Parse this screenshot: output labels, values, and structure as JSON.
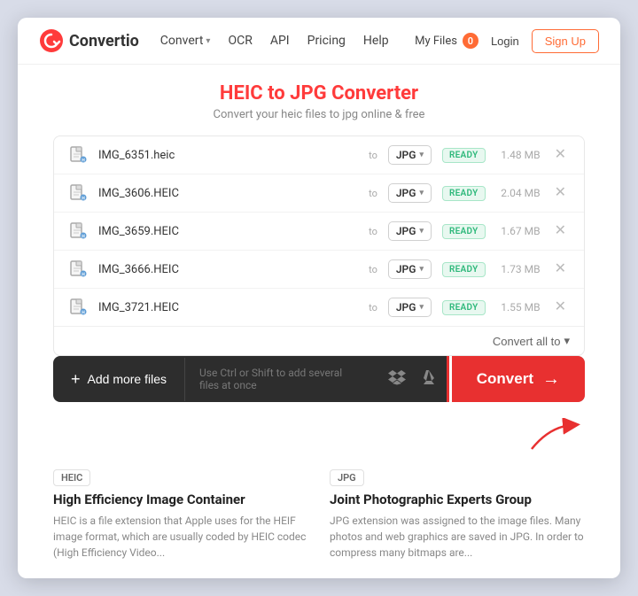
{
  "site": {
    "logo_text": "Convertio",
    "nav": {
      "convert": "Convert",
      "ocr": "OCR",
      "api": "API",
      "pricing": "Pricing",
      "help": "Help",
      "my_files": "My Files",
      "my_files_count": "0",
      "login": "Login",
      "signup": "Sign Up"
    }
  },
  "page": {
    "title": "HEIC to JPG Converter",
    "subtitle": "Convert your heic files to jpg online & free"
  },
  "files": [
    {
      "name": "IMG_6351.heic",
      "format": "JPG",
      "status": "READY",
      "size": "1.48 MB"
    },
    {
      "name": "IMG_3606.HEIC",
      "format": "JPG",
      "status": "READY",
      "size": "2.04 MB"
    },
    {
      "name": "IMG_3659.HEIC",
      "format": "JPG",
      "status": "READY",
      "size": "1.67 MB"
    },
    {
      "name": "IMG_3666.HEIC",
      "format": "JPG",
      "status": "READY",
      "size": "1.73 MB"
    },
    {
      "name": "IMG_3721.HEIC",
      "format": "JPG",
      "status": "READY",
      "size": "1.55 MB"
    }
  ],
  "toolbar": {
    "convert_all": "Convert all to",
    "add_files": "Add more files",
    "drop_hint": "Use Ctrl or Shift to add several files at once",
    "convert_btn": "Convert"
  },
  "info": {
    "left": {
      "tag": "HEIC",
      "title": "High Efficiency Image Container",
      "description": "HEIC is a file extension that Apple uses for the HEIF image format, which are usually coded by HEIC codec (High Efficiency Video..."
    },
    "right": {
      "tag": "JPG",
      "title": "Joint Photographic Experts Group",
      "description": "JPG extension was assigned to the image files. Many photos and web graphics are saved in JPG. In order to compress many bitmaps are..."
    }
  },
  "colors": {
    "accent": "#e83030",
    "logo_accent": "#e83030",
    "ready_green": "#2db87a"
  }
}
